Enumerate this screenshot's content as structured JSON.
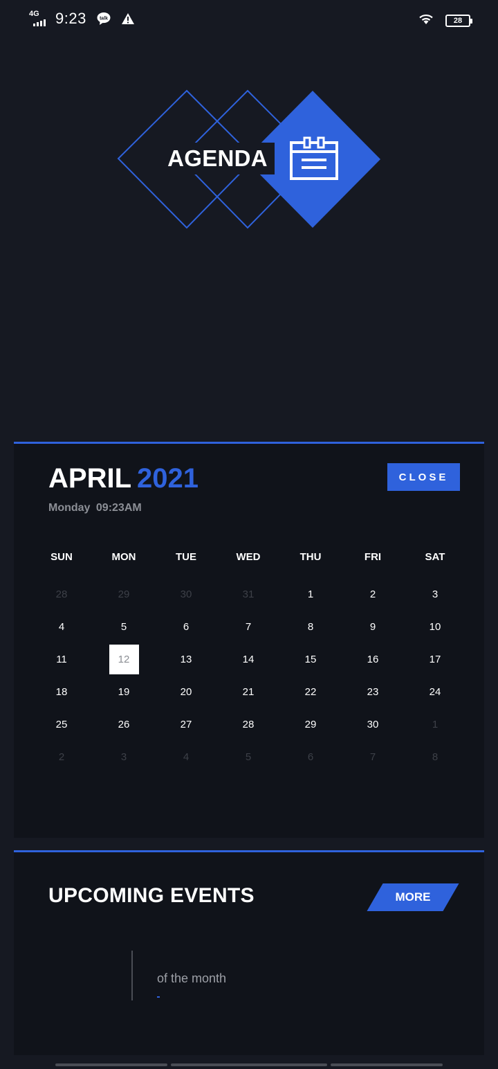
{
  "status": {
    "network": "4G",
    "time": "9:23",
    "battery": "28",
    "icons": [
      "talk-icon",
      "warning-icon",
      "wifi-icon",
      "battery-icon"
    ]
  },
  "logo": {
    "text": "AGENDA",
    "icon": "calendar-icon",
    "accent": "#2f62dc"
  },
  "calendar": {
    "month": "APRIL",
    "year": "2021",
    "subdate": "Monday 09:23AM",
    "close_label": "CLOSE",
    "weekdays": [
      "SUN",
      "MON",
      "TUE",
      "WED",
      "THU",
      "FRI",
      "SAT"
    ],
    "weeks": [
      [
        {
          "d": "28",
          "m": false
        },
        {
          "d": "29",
          "m": false
        },
        {
          "d": "30",
          "m": false
        },
        {
          "d": "31",
          "m": false
        },
        {
          "d": "1",
          "m": true
        },
        {
          "d": "2",
          "m": true
        },
        {
          "d": "3",
          "m": true
        }
      ],
      [
        {
          "d": "4",
          "m": true
        },
        {
          "d": "5",
          "m": true
        },
        {
          "d": "6",
          "m": true
        },
        {
          "d": "7",
          "m": true
        },
        {
          "d": "8",
          "m": true
        },
        {
          "d": "9",
          "m": true
        },
        {
          "d": "10",
          "m": true
        }
      ],
      [
        {
          "d": "11",
          "m": true
        },
        {
          "d": "12",
          "m": true,
          "today": true
        },
        {
          "d": "13",
          "m": true
        },
        {
          "d": "14",
          "m": true
        },
        {
          "d": "15",
          "m": true
        },
        {
          "d": "16",
          "m": true
        },
        {
          "d": "17",
          "m": true
        }
      ],
      [
        {
          "d": "18",
          "m": true
        },
        {
          "d": "19",
          "m": true
        },
        {
          "d": "20",
          "m": true
        },
        {
          "d": "21",
          "m": true
        },
        {
          "d": "22",
          "m": true
        },
        {
          "d": "23",
          "m": true
        },
        {
          "d": "24",
          "m": true
        }
      ],
      [
        {
          "d": "25",
          "m": true
        },
        {
          "d": "26",
          "m": true
        },
        {
          "d": "27",
          "m": true
        },
        {
          "d": "28",
          "m": true
        },
        {
          "d": "29",
          "m": true
        },
        {
          "d": "30",
          "m": true
        },
        {
          "d": "1",
          "m": false
        }
      ],
      [
        {
          "d": "2",
          "m": false
        },
        {
          "d": "3",
          "m": false
        },
        {
          "d": "4",
          "m": false
        },
        {
          "d": "5",
          "m": false
        },
        {
          "d": "6",
          "m": false
        },
        {
          "d": "7",
          "m": false
        },
        {
          "d": "8",
          "m": false
        }
      ]
    ]
  },
  "events": {
    "title": "UPCOMING EVENTS",
    "more_label": "MORE",
    "item_text": "of the month"
  }
}
